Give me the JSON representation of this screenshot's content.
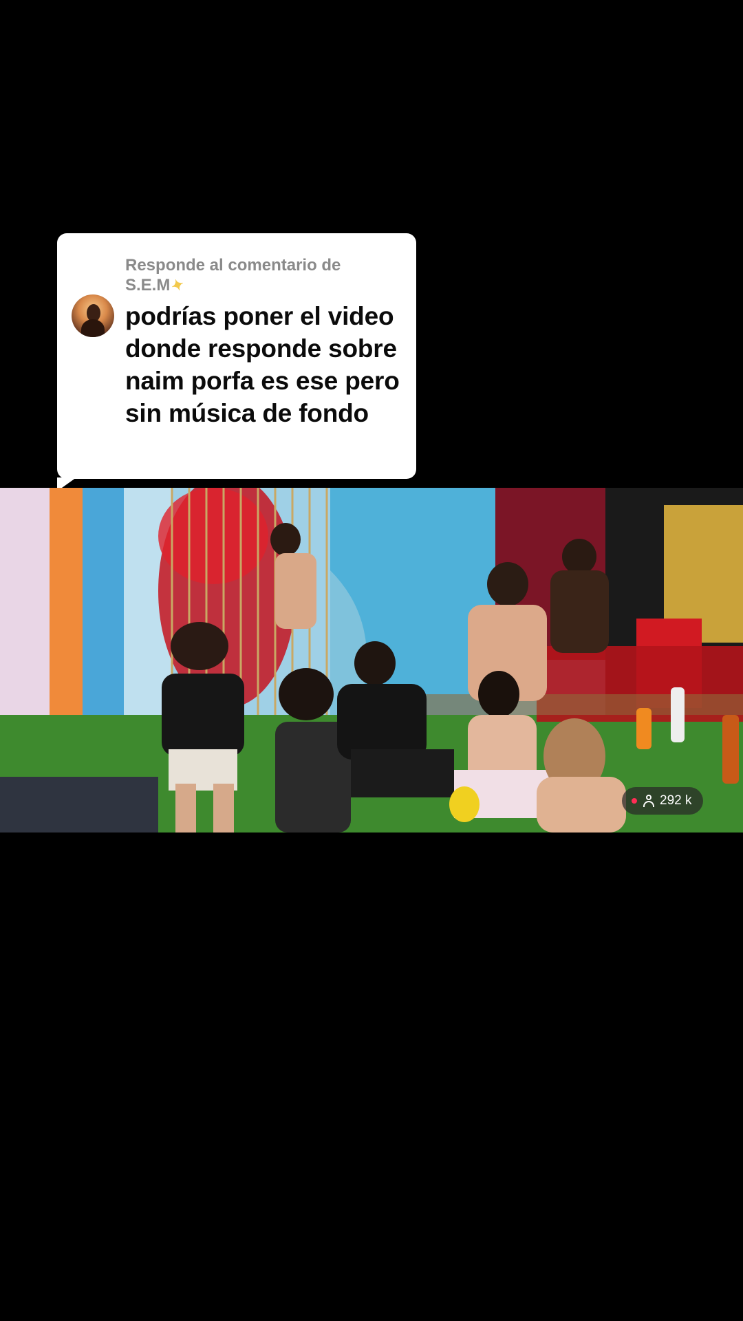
{
  "reply_sticker": {
    "header": "Responde al comentario de",
    "username": "S.E.M",
    "username_emoji_icon": "dizzy-sparkle-icon",
    "comment_text": "podrías poner el video donde responde sobre naim porfa es ese pero sin música de fondo",
    "avatar_icon": "user-avatar"
  },
  "video": {
    "description": "reality show living room scene"
  },
  "live_badge": {
    "viewer_count": "292 k",
    "live_dot_color": "#ff2d55",
    "icon": "person-icon"
  },
  "colors": {
    "background": "#000000",
    "sticker_bg": "#ffffff",
    "header_text": "#8a8a8a",
    "comment_text": "#0b0b0b"
  }
}
